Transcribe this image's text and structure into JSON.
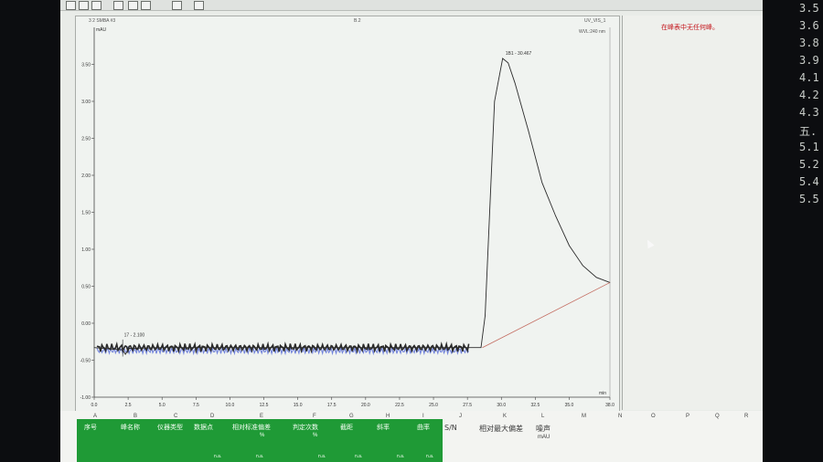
{
  "toolbar": {
    "icons": [
      "new-icon",
      "open-icon",
      "save-icon",
      "print-icon",
      "table-icon",
      "grid-icon",
      "zoom-icon",
      "help-icon"
    ]
  },
  "chart": {
    "header_left": "3 2 SMBA #3",
    "header_center": "B.2",
    "header_right": "UV_VIS_1",
    "wavelength": "WVL:240 nm",
    "y_unit": "mAU",
    "x_unit": "min",
    "peak1_label": "17 - 2.100",
    "peak2_label": "1B1 - 30.467",
    "line_color": "#2b2b2b",
    "baseline_color": "#c46d62",
    "noise_color": "#4a5fd6"
  },
  "chart_data": {
    "type": "line",
    "x_ticks": [
      "0.0",
      "2.5",
      "5.0",
      "7.5",
      "10.0",
      "12.5",
      "15.0",
      "17.5",
      "20.0",
      "22.5",
      "25.0",
      "27.5",
      "30.0",
      "32.5",
      "35.0",
      "38.0"
    ],
    "y_ticks": [
      "-1.00",
      "-0.50",
      "0.00",
      "0.50",
      "1.00",
      "1.50",
      "2.00",
      "2.50",
      "3.00",
      "3.50"
    ],
    "xlim": [
      0,
      38
    ],
    "ylim": [
      -1.0,
      4.0
    ],
    "xlabel": "min",
    "ylabel": "mAU",
    "series": [
      {
        "x": [
          0.0,
          2.1,
          2.3,
          2.6,
          5.0,
          10.0,
          15.0,
          20.0,
          25.0,
          28.5,
          28.8,
          29.5,
          30.1,
          30.5,
          31.0,
          32.0,
          33.0,
          34.0,
          35.0,
          36.0,
          37.0,
          38.0
        ],
        "values": [
          -0.33,
          -0.36,
          -0.42,
          -0.34,
          -0.33,
          -0.33,
          -0.33,
          -0.33,
          -0.33,
          -0.33,
          0.1,
          3.0,
          3.58,
          3.52,
          3.25,
          2.6,
          1.9,
          1.45,
          1.05,
          0.78,
          0.62,
          0.55
        ]
      }
    ],
    "grid": false
  },
  "report": {
    "message": "在峰表中无任何峰。"
  },
  "sheet": {
    "columns": [
      "A",
      "B",
      "C",
      "D",
      "E",
      "F",
      "G",
      "H",
      "I",
      "J",
      "K",
      "L",
      "M",
      "N",
      "O",
      "P",
      "Q",
      "R"
    ],
    "headers": [
      "序号",
      "峰名称",
      "仪器类型",
      "数据点",
      "相对标准偏差",
      "判定次数",
      "截距",
      "斜率",
      "曲率",
      "S/N",
      "相对最大偏差",
      "噪声"
    ],
    "units": {
      "rsd": "%",
      "count": "%",
      "noise": "mAU"
    },
    "na": "n.a."
  },
  "right_text": [
    "3.5",
    "3.6",
    "3.8",
    "3.9",
    "4.1",
    "4.2",
    "4.3",
    "五.",
    "5.1",
    "5.2",
    "5.4",
    "5.5"
  ]
}
